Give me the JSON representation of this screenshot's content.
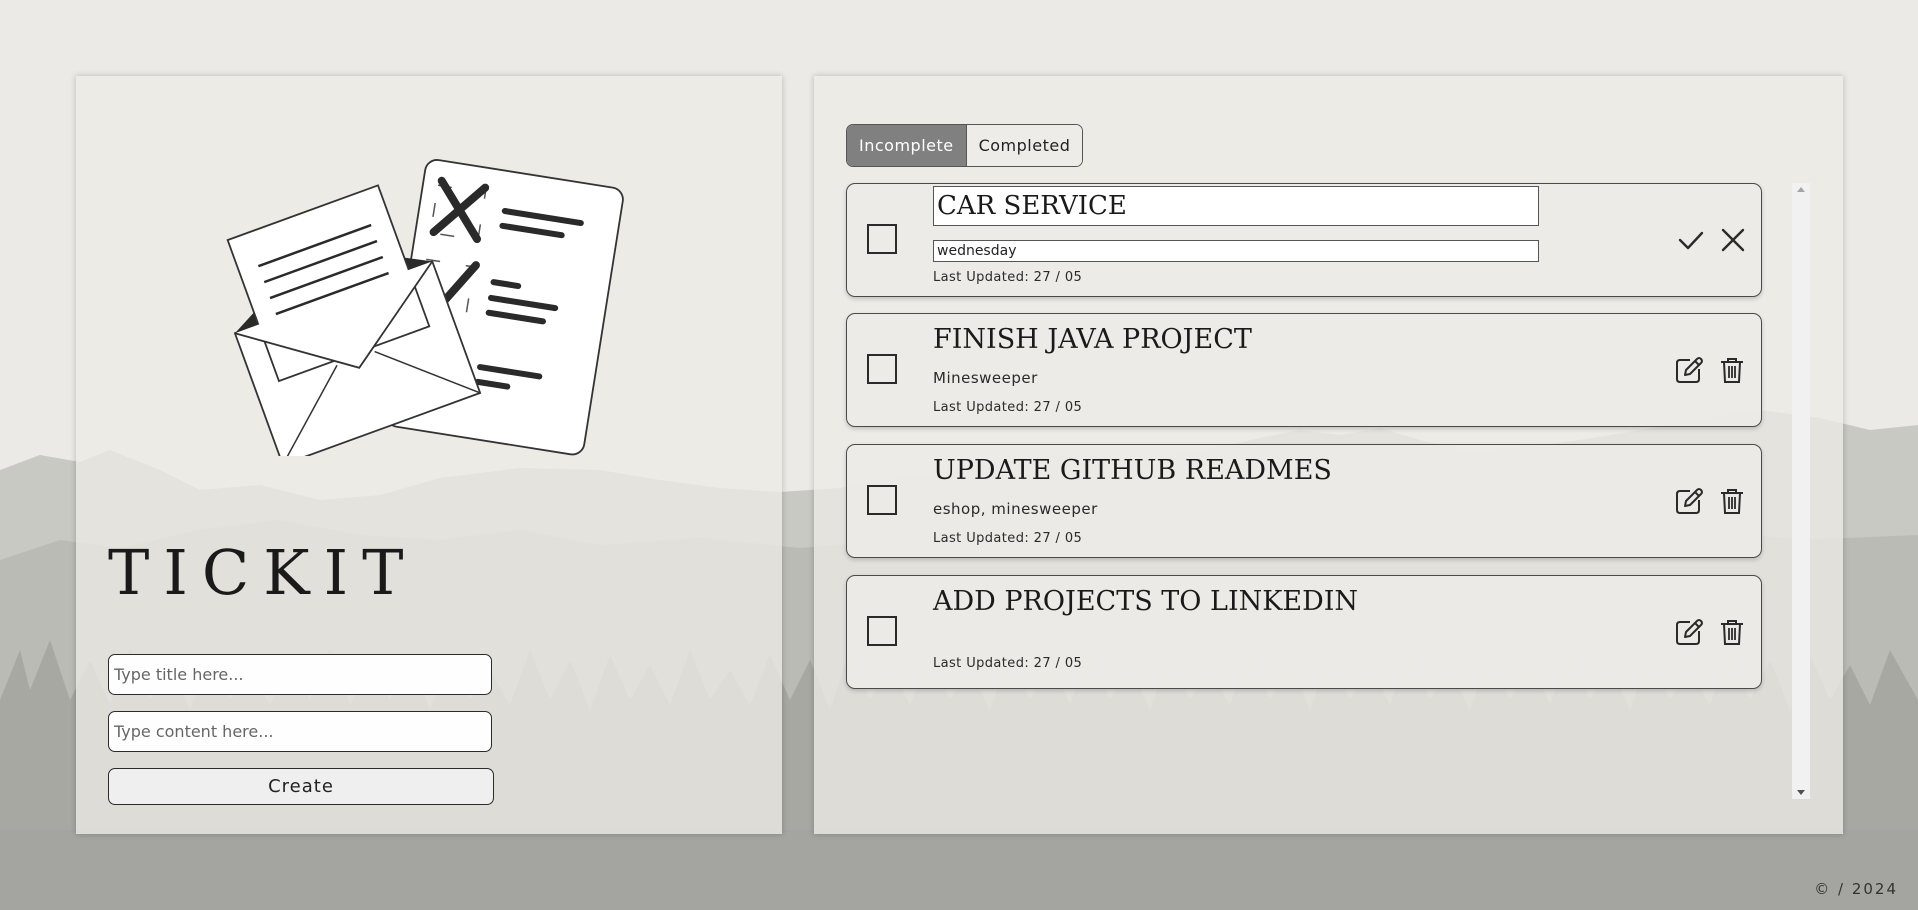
{
  "app": {
    "title": "TICKIT"
  },
  "form": {
    "title_placeholder": "Type title here...",
    "content_placeholder": "Type content here...",
    "create_label": "Create"
  },
  "tabs": [
    {
      "label": "Incomplete",
      "active": true
    },
    {
      "label": "Completed",
      "active": false
    }
  ],
  "tasks": [
    {
      "title": "CAR SERVICE",
      "content": "wednesday",
      "updated": "Last Updated: 27 / 05",
      "editing": true,
      "done": false
    },
    {
      "title": "FINISH JAVA PROJECT",
      "content": "Minesweeper",
      "updated": "Last Updated: 27 / 05",
      "editing": false,
      "done": false
    },
    {
      "title": "UPDATE GITHUB READMES",
      "content": "eshop, minesweeper",
      "updated": "Last Updated: 27 / 05",
      "editing": false,
      "done": false
    },
    {
      "title": "ADD PROJECTS TO LINKEDIN",
      "content": "",
      "updated": "Last Updated: 27 / 05",
      "editing": false,
      "done": false
    }
  ],
  "icons": {
    "edit": "pencil-square-icon",
    "delete": "trash-icon",
    "confirm": "check-icon",
    "cancel": "close-icon"
  },
  "footer": {
    "text": "© / 2024"
  },
  "colors": {
    "background": "#ebeae6",
    "active_tab": "#808080",
    "mountain": "#a8a8a3"
  }
}
